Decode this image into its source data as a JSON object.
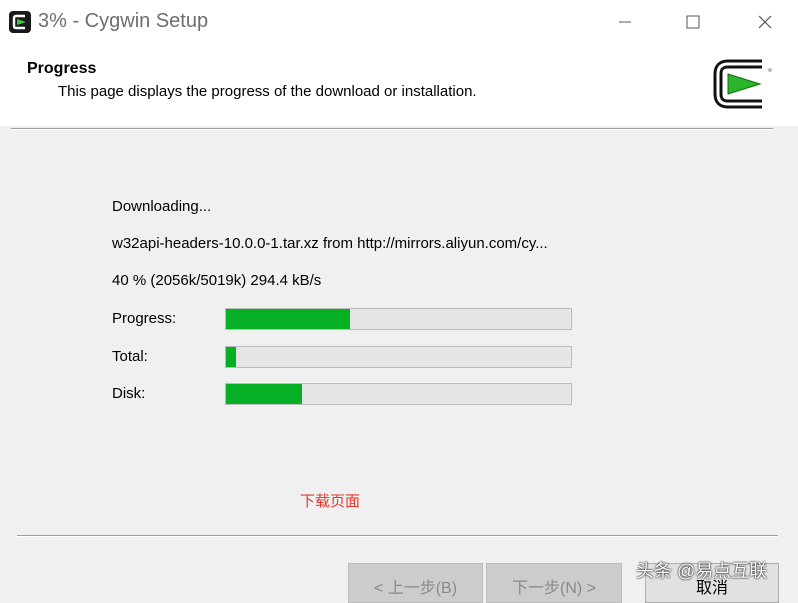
{
  "window": {
    "title": "3% - Cygwin Setup",
    "controls": [
      "minimize-icon",
      "maximize-icon",
      "close-icon"
    ]
  },
  "header": {
    "title": "Progress",
    "subtitle": "This page displays the progress of the download or installation."
  },
  "status": {
    "action": "Downloading...",
    "file": "w32api-headers-10.0.0-1.tar.xz from http://mirrors.aliyun.com/cy...",
    "percent_line": "40 %  (2056k/5019k)  294.4 kB/s"
  },
  "bars": {
    "progress": {
      "label": "Progress:",
      "fraction": 0.36
    },
    "total": {
      "label": "Total:",
      "fraction": 0.03
    },
    "disk": {
      "label": "Disk:",
      "fraction": 0.22
    },
    "fill_color": "#06b025"
  },
  "note": "下载页面",
  "buttons": {
    "back": "< 上一步(B)",
    "next": "下一步(N) >",
    "cancel": "取消"
  },
  "watermark": "头条 @易点互联"
}
